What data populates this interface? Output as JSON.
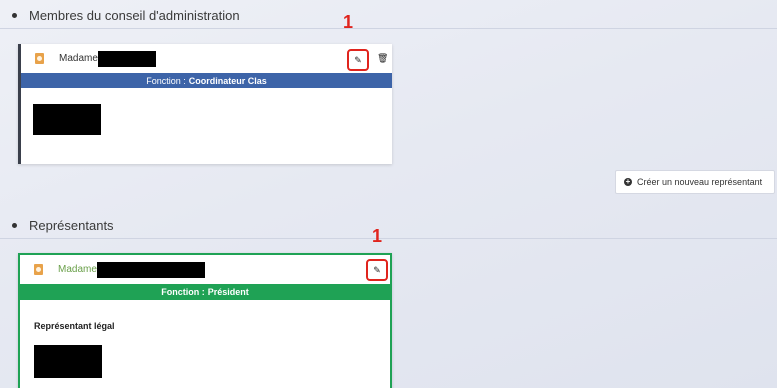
{
  "sections": {
    "board": {
      "title": "Membres du conseil d'administration"
    },
    "representatives": {
      "title": "Représentants"
    }
  },
  "board_card": {
    "civility": "Madame",
    "function_label": "Fonction : ",
    "function_value": "Coordinateur Clas"
  },
  "rep_card": {
    "civility": "Madame",
    "function_label": "Fonction : ",
    "function_value": "Président",
    "role": "Représentant légal"
  },
  "create_button": {
    "label": "Créer un nouveau représentant"
  },
  "callouts": {
    "first": "1",
    "second": "1"
  },
  "icons": {
    "edit": "pencil-icon",
    "delete": "trash-icon",
    "person": "person-badge-icon",
    "create": "plus-circle-icon"
  },
  "colors": {
    "board_bar": "#3d64a8",
    "rep_bar": "#1fa255",
    "callout": "#e0241d"
  }
}
